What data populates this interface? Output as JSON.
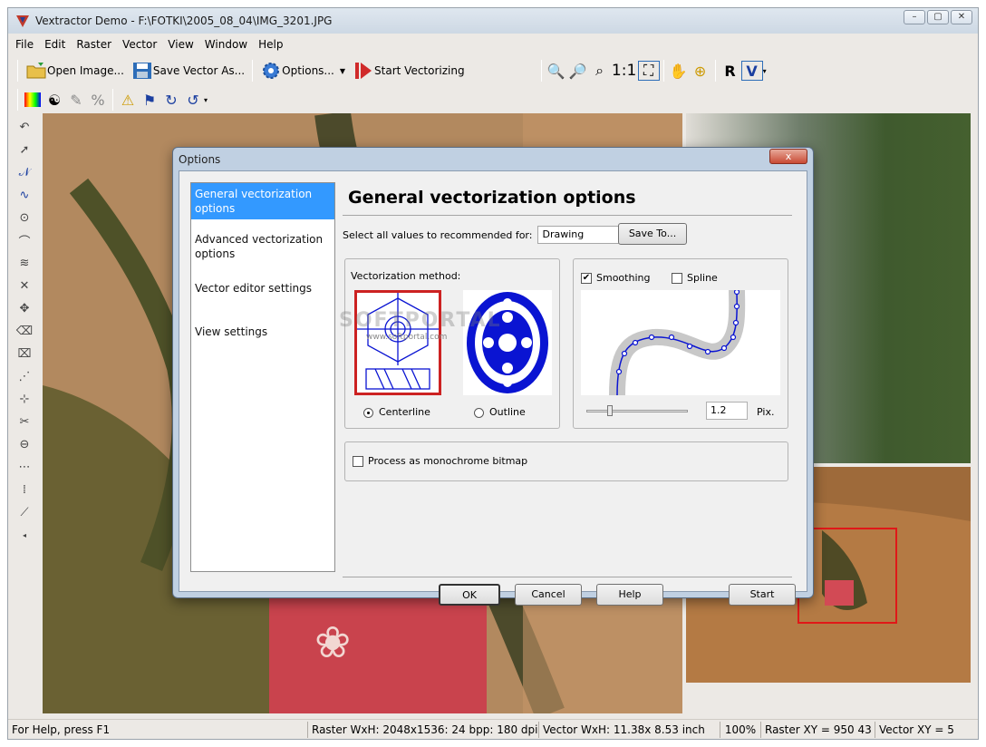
{
  "app": {
    "title": "Vextractor Demo - F:\\FOTKI\\2005_08_04\\IMG_3201.JPG",
    "window_buttons": [
      "minimize",
      "maximize",
      "close"
    ]
  },
  "menu": [
    "File",
    "Edit",
    "Raster",
    "Vector",
    "View",
    "Window",
    "Help"
  ],
  "toolbar": {
    "open_label": "Open Image...",
    "save_label": "Save Vector As...",
    "options_label": "Options...",
    "start_label": "Start Vectorizing",
    "zoom_actual": "1:1"
  },
  "status": {
    "help": "For Help, press F1",
    "raster": "Raster WxH: 2048x1536: 24 bpp: 180 dpi",
    "vector": "Vector WxH: 11.38x 8.53 inch",
    "zoom": "100%",
    "raster_xy": "Raster XY =   950  43",
    "vector_xy": "Vector XY =   5"
  },
  "dialog": {
    "title": "Options",
    "close": "x",
    "nav": [
      "General vectorization options",
      "Advanced vectorization options",
      "Vector editor settings",
      "View settings"
    ],
    "selected_nav": 0,
    "heading": "General vectorization options",
    "recommend_label": "Select all values to recommended for:",
    "recommend_value": "Drawing",
    "save_to": "Save To...",
    "method_label": "Vectorization method:",
    "method_centerline": "Centerline",
    "method_outline": "Outline",
    "method_selected": "Centerline",
    "smoothing_label": "Smoothing",
    "smoothing_checked": true,
    "spline_label": "Spline",
    "spline_checked": false,
    "smooth_value": "1.2",
    "smooth_unit": "Pix.",
    "monochrome_label": "Process as monochrome bitmap",
    "monochrome_checked": false,
    "ok": "OK",
    "cancel": "Cancel",
    "help": "Help",
    "start": "Start",
    "watermark": "SOFTPORTAL",
    "watermark_url": "www.softportal.com"
  },
  "colors": {
    "selection": "#3399ff",
    "highlight_border": "#cc2222",
    "vector_blue": "#0a14d2"
  }
}
